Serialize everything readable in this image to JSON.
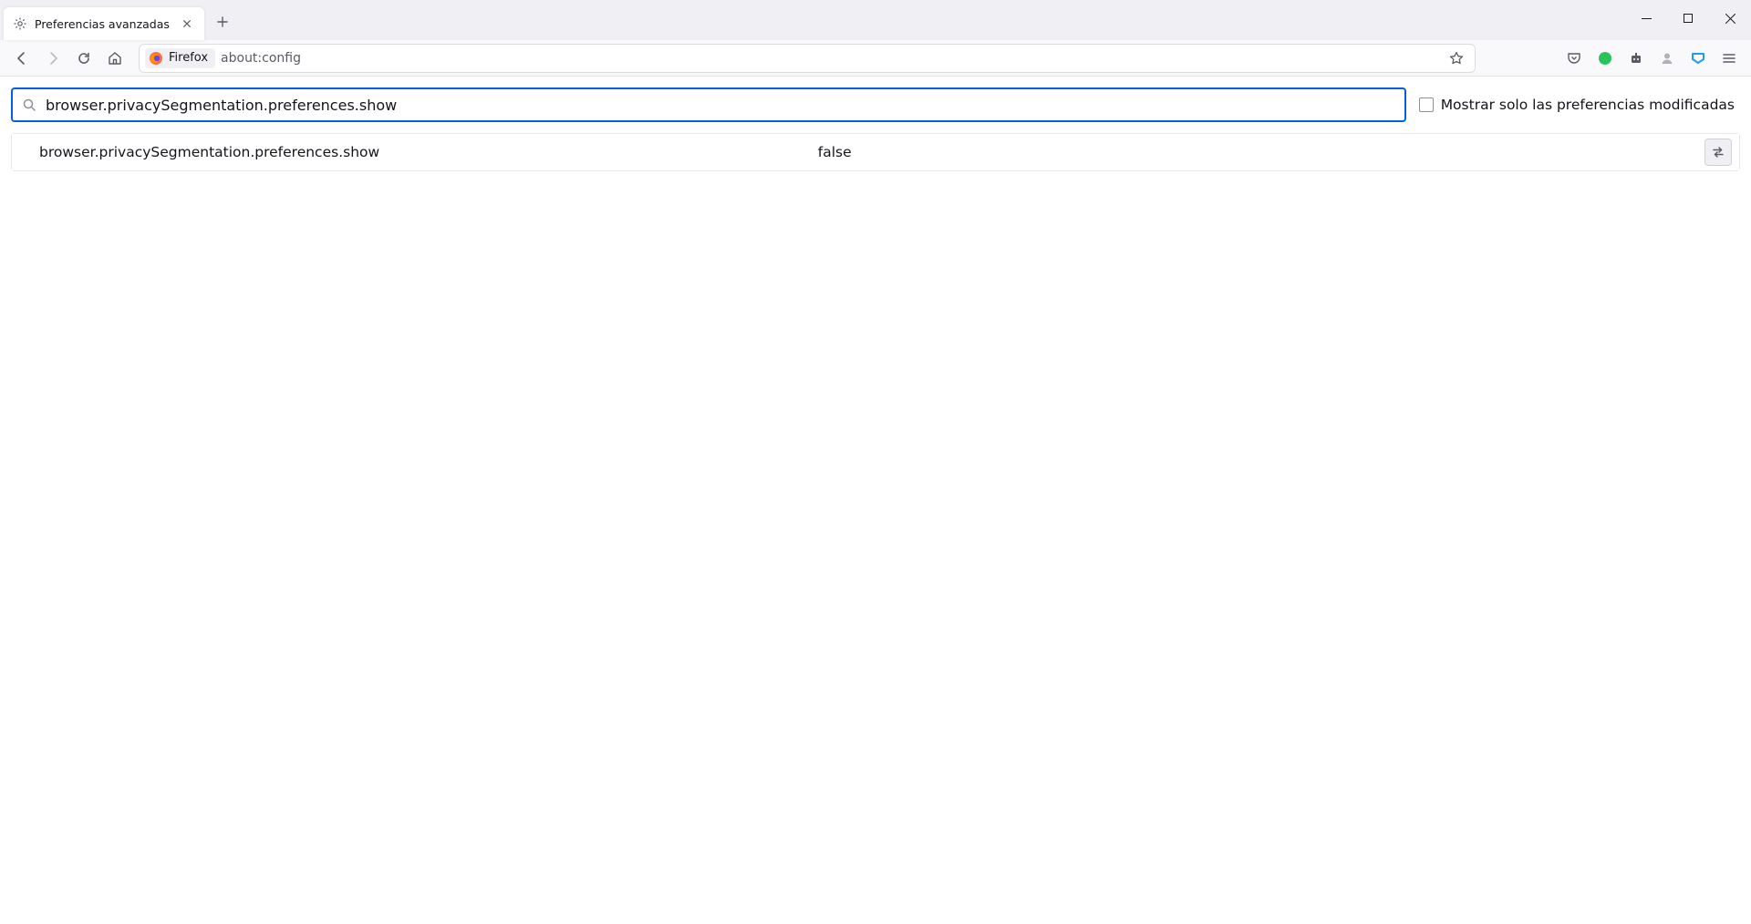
{
  "window": {
    "minimize_tooltip": "Minimize",
    "maximize_tooltip": "Maximize",
    "close_tooltip": "Close"
  },
  "tabs": {
    "items": [
      {
        "title": "Preferencias avanzadas"
      }
    ],
    "newtab_tooltip": "New Tab"
  },
  "nav": {
    "back_tooltip": "Back",
    "forward_tooltip": "Forward",
    "reload_tooltip": "Reload",
    "home_tooltip": "Home"
  },
  "urlbar": {
    "identity_label": "Firefox",
    "url": "about:config",
    "bookmark_tooltip": "Bookmark this page"
  },
  "toolbar": {
    "pocket_tooltip": "Save to Pocket",
    "ext1_tooltip": "Extension",
    "ext2_tooltip": "Extension",
    "account_tooltip": "Firefox account",
    "ext3_tooltip": "Extension",
    "menu_tooltip": "Open application menu"
  },
  "config": {
    "search_value": "browser.privacySegmentation.preferences.show",
    "show_modified_label": "Mostrar solo las preferencias modificadas",
    "prefs": [
      {
        "name": "browser.privacySegmentation.preferences.show",
        "value": "false",
        "action_tooltip": "Toggle"
      }
    ]
  },
  "colors": {
    "focus": "#0060df",
    "ext_green": "#2ac3a2",
    "ext_blue": "#1e9df0"
  }
}
